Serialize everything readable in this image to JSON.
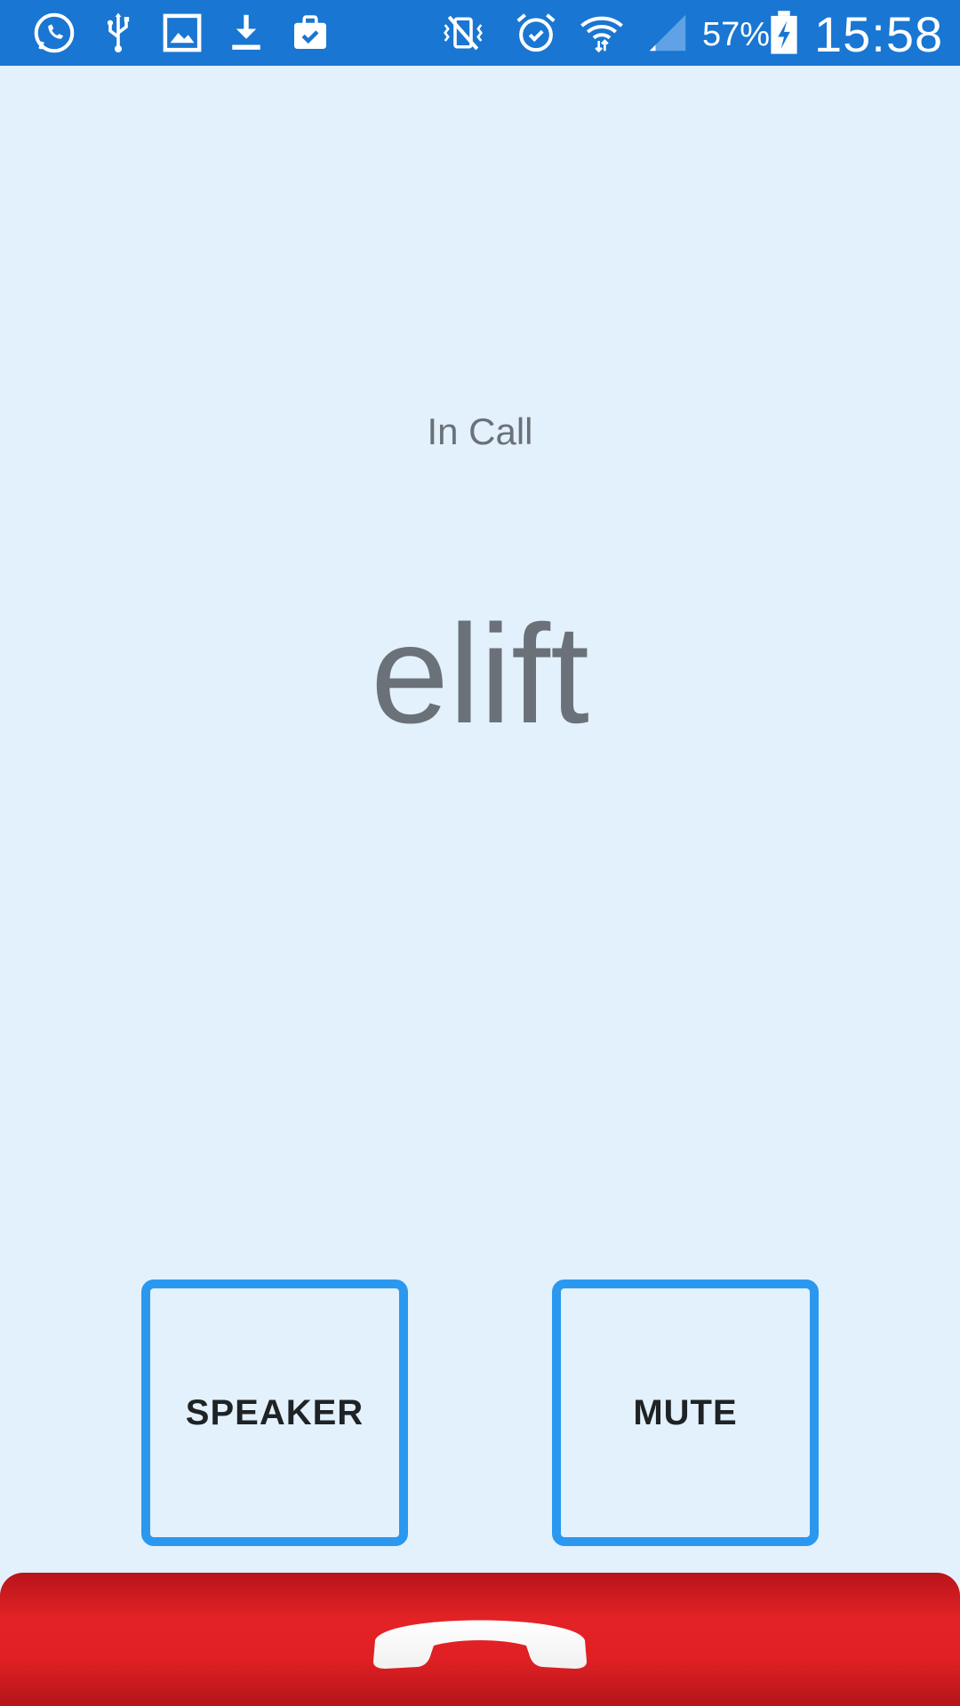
{
  "status_bar": {
    "background_color": "#1976d2",
    "left_icons": [
      "whatsapp-icon",
      "usb-icon",
      "gallery-icon",
      "download-icon",
      "clipboard-check-icon"
    ],
    "right_icons": [
      "vibrate-silent-icon",
      "alarm-icon",
      "wifi-icon",
      "signal-icon",
      "battery-charging-icon"
    ],
    "battery_percent": "57%",
    "time": "15:58"
  },
  "call": {
    "status": "In Call",
    "caller_name": "elift"
  },
  "actions": {
    "speaker_label": "SPEAKER",
    "mute_label": "MUTE",
    "button_border_color": "#2b98ef"
  },
  "end_call": {
    "icon": "hang-up-phone-icon",
    "color": "#e32226"
  }
}
